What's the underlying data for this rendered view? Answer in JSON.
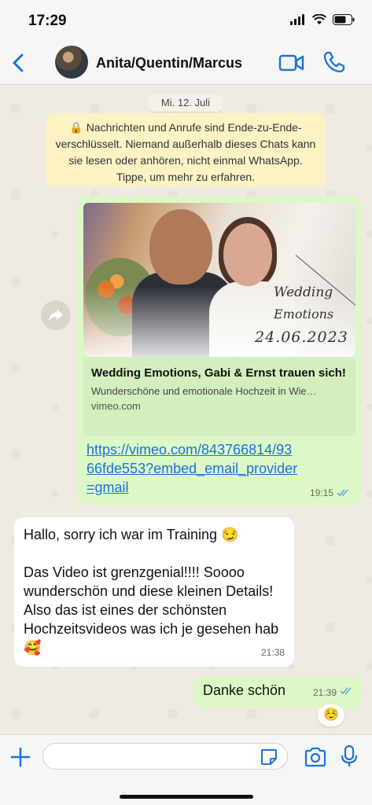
{
  "status_bar": {
    "time": "17:29"
  },
  "header": {
    "title": "Anita/Quentin/Marcus"
  },
  "chat": {
    "date_label": "Mi. 12. Juli",
    "encryption_notice": "Nachrichten und Anrufe sind Ende-zu-Ende-verschlüsselt. Niemand außerhalb dieses Chats kann sie lesen oder anhören, nicht einmal WhatsApp. Tippe, um mehr zu erfahren.",
    "link_message": {
      "preview_overlay_1": "Wedding",
      "preview_overlay_2": "Emotions",
      "preview_overlay_3": "24.06.2023",
      "preview_title": "Wedding Emotions, Gabi & Ernst trauen sich!",
      "preview_description": "Wunderschöne und emotionale Hochzeit in Wie…",
      "preview_domain": "vimeo.com",
      "link": "https://vimeo.com/843766814/9366fde553?embed_email_provider=gmail",
      "time": "19:15"
    },
    "incoming_message": {
      "line1": "Hallo, sorry ich war im Training 😏",
      "line2": "Das Video ist grenzgenial!!!! Soooo wunderschön und diese kleinen Details! Also das ist eines der schönsten Hochzeitsvideos was ich je gesehen hab 🥰",
      "time": "21:38"
    },
    "outgoing_reply": {
      "text": "Danke schön",
      "time": "21:39",
      "reaction": "☺️"
    }
  },
  "input_bar": {
    "placeholder": ""
  },
  "colors": {
    "accent": "#1b74d8",
    "outgoing_bubble": "#dcf8c6",
    "incoming_bubble": "#ffffff",
    "notice_bg": "#fcf2c4",
    "read_ticks": "#53a6e6"
  }
}
